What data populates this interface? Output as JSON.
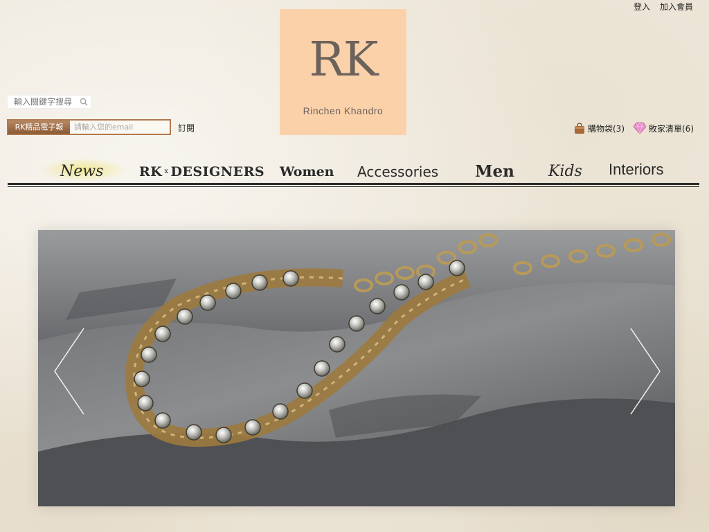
{
  "header": {
    "login": "登入",
    "join": "加入會員"
  },
  "logo": {
    "mark": "RK",
    "name": "Rinchen Khandro",
    "bg_color": "#fbd1aa"
  },
  "search": {
    "placeholder": "輸入關鍵字搜尋",
    "icon": "search-icon"
  },
  "newsletter": {
    "tag": "RK精品電子報",
    "placeholder": "請輸入您的email",
    "subscribe": "訂閱"
  },
  "shop": {
    "cart_label": "購物袋(3)",
    "cart_icon": "shopping-bag-icon",
    "wishlist_label": "敗家清單(6)",
    "wishlist_icon": "diamond-icon"
  },
  "nav": {
    "news": "News",
    "rk": "RK",
    "x": "x",
    "designers": "DESIGNERS",
    "women": "Women",
    "accessories": "Accessories",
    "men": "Men",
    "kids": "Kids",
    "interiors": "Interiors"
  },
  "slider": {
    "prev_icon": "chevron-left-icon",
    "next_icon": "chevron-right-icon",
    "image_subject": "bronze chain necklace with crystal stones on slate rock"
  }
}
